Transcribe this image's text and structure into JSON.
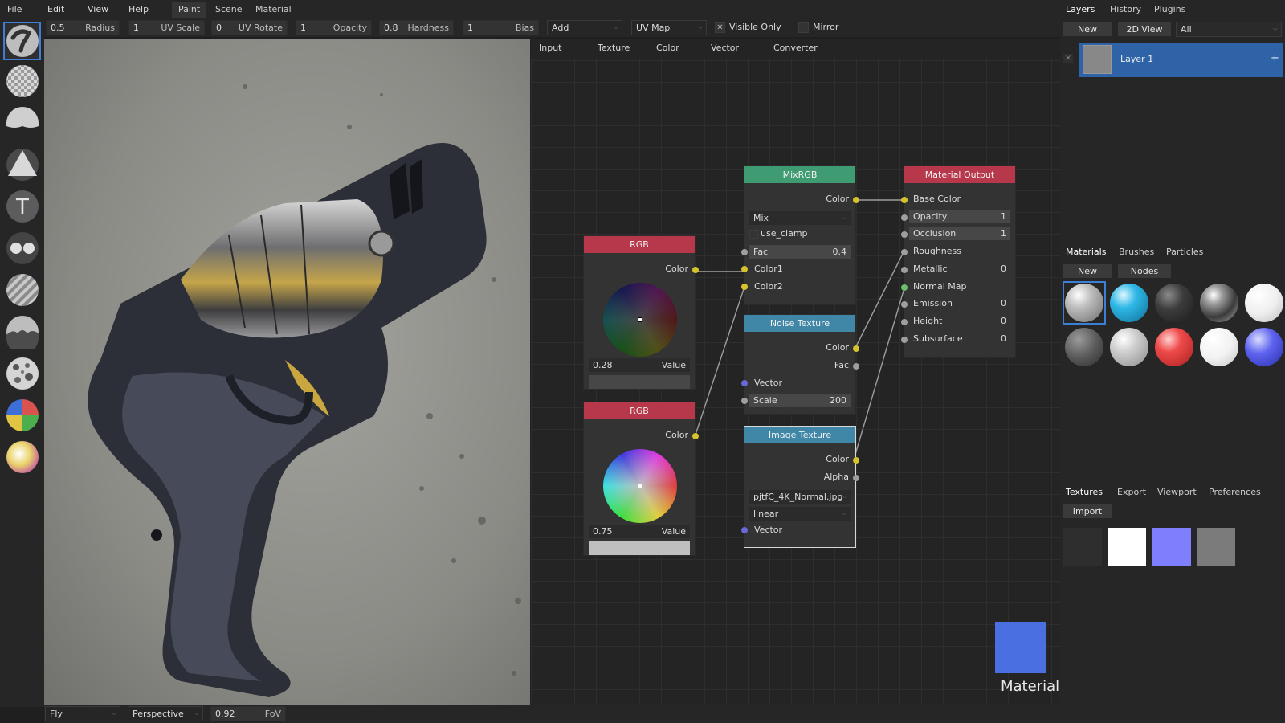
{
  "menu": [
    "File",
    "Edit",
    "View",
    "Help"
  ],
  "workspace_tabs": [
    "Paint",
    "Scene",
    "Material"
  ],
  "tool_options": {
    "radius": {
      "value": "0.5",
      "label": "Radius"
    },
    "uv_scale": {
      "value": "1",
      "label": "UV Scale"
    },
    "uv_rotate": {
      "value": "0",
      "label": "UV Rotate"
    },
    "opacity": {
      "value": "1",
      "label": "Opacity"
    },
    "hardness": {
      "value": "0.8",
      "label": "Hardness"
    },
    "bias": {
      "value": "1",
      "label": "Bias"
    },
    "blend": "Add",
    "uv_map": "UV Map",
    "visible_only": "Visible Only",
    "mirror": "Mirror"
  },
  "tools": [
    "brush-icon",
    "checker-icon",
    "bump-icon",
    "triangle-icon",
    "text-icon",
    "clone-icon",
    "stripes-icon",
    "smudge-icon",
    "noise-sphere-icon",
    "color-id-icon",
    "picker-icon"
  ],
  "node_menu": [
    "Input",
    "Texture",
    "Color",
    "Vector",
    "Converter"
  ],
  "nodes": {
    "rgb1": {
      "title": "RGB",
      "out": "Color",
      "value": "0.28",
      "value_label": "Value"
    },
    "rgb2": {
      "title": "RGB",
      "out": "Color",
      "value": "0.75",
      "value_label": "Value"
    },
    "mix": {
      "title": "MixRGB",
      "out": "Color",
      "mode": "Mix",
      "clamp": "use_clamp",
      "fac_label": "Fac",
      "fac_value": "0.4",
      "color1": "Color1",
      "color2": "Color2"
    },
    "noise": {
      "title": "Noise Texture",
      "out_color": "Color",
      "out_fac": "Fac",
      "vector": "Vector",
      "scale_label": "Scale",
      "scale_value": "200"
    },
    "image": {
      "title": "Image Texture",
      "out_color": "Color",
      "out_alpha": "Alpha",
      "file": "pjtfC_4K_Normal.jpg",
      "interp": "linear",
      "vector": "Vector"
    },
    "output": {
      "title": "Material Output",
      "inputs": [
        {
          "label": "Base Color",
          "value": ""
        },
        {
          "label": "Opacity",
          "value": "1"
        },
        {
          "label": "Occlusion",
          "value": "1"
        },
        {
          "label": "Roughness",
          "value": ""
        },
        {
          "label": "Metallic",
          "value": "0"
        },
        {
          "label": "Normal Map",
          "value": ""
        },
        {
          "label": "Emission",
          "value": "0"
        },
        {
          "label": "Height",
          "value": "0"
        },
        {
          "label": "Subsurface",
          "value": "0"
        }
      ]
    }
  },
  "preview_label": "Material",
  "layers_panel": {
    "tabs": [
      "Layers",
      "History",
      "Plugins"
    ],
    "new": "New",
    "view2d": "2D View",
    "filter": "All",
    "layer_name": "Layer 1"
  },
  "materials_panel": {
    "tabs": [
      "Materials",
      "Brushes",
      "Particles"
    ],
    "new": "New",
    "nodes": "Nodes"
  },
  "textures_panel": {
    "tabs": [
      "Textures",
      "Export",
      "Viewport",
      "Preferences"
    ],
    "import": "Import"
  },
  "status": {
    "camera_mode": "Fly",
    "projection": "Perspective",
    "fov_value": "0.92",
    "fov_label": "FoV"
  },
  "colors": {
    "accent": "#3d7fd6",
    "rgb_header": "#b6384a",
    "mix_header": "#3f9b71",
    "noise_header": "#3f86a7",
    "output_header": "#b6384a",
    "socket_color": "#d6c22c",
    "socket_vector": "#6868d8",
    "socket_normal": "#69c069"
  }
}
